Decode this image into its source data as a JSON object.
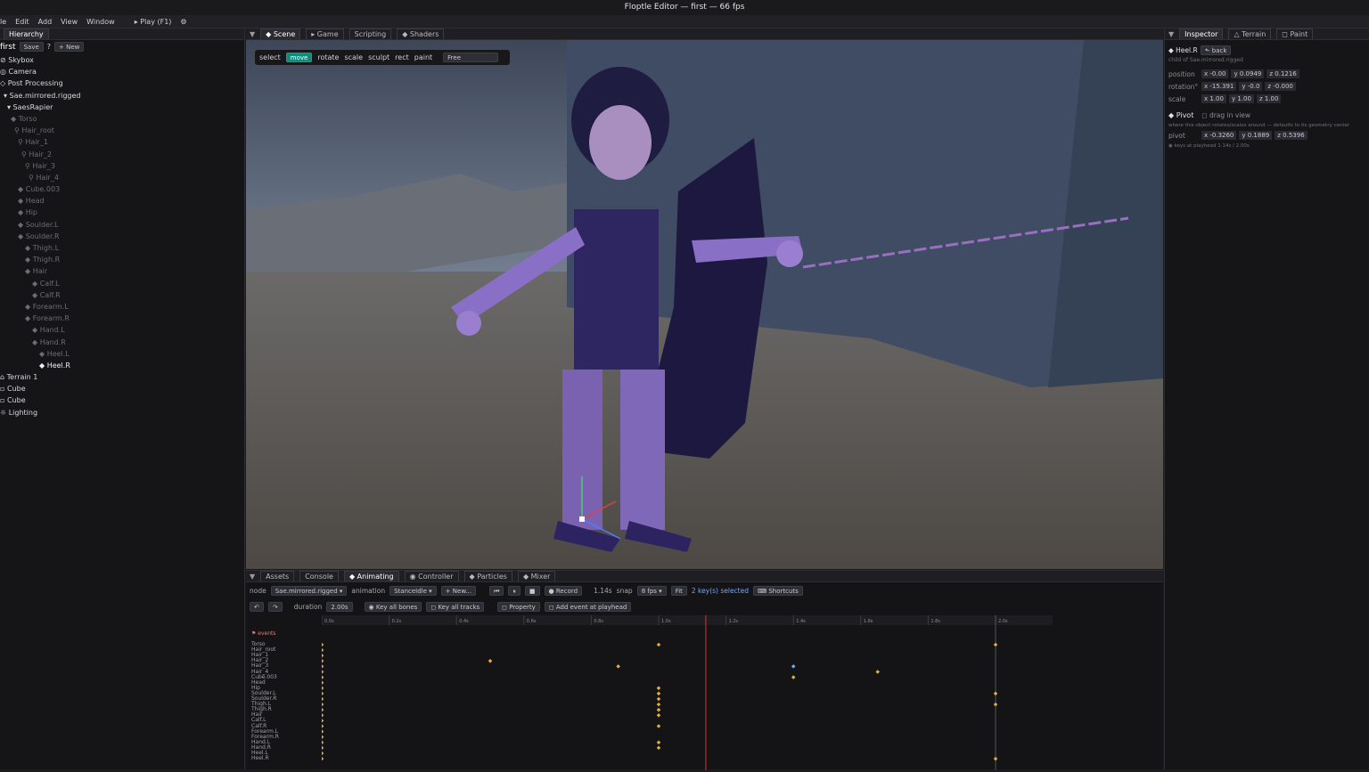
{
  "window": {
    "title": "Floptle Editor — first — 66 fps"
  },
  "menu": {
    "file": "le",
    "edit": "Edit",
    "add": "Add",
    "view": "View",
    "window": "Window",
    "play": "▸ Play (F1)",
    "gear": "⚙"
  },
  "hierarchy": {
    "tab": "Hierarchy",
    "project": "first",
    "save": "Save",
    "help": "?",
    "new": "+ New",
    "items": [
      {
        "label": "⊘ Skybox",
        "indent": 0,
        "dim": false
      },
      {
        "label": "◎ Camera",
        "indent": 0,
        "dim": false
      },
      {
        "label": "◇ Post Processing",
        "indent": 0,
        "dim": false
      },
      {
        "label": "▾ Sae.mirrored.rigged",
        "indent": 1,
        "dim": false
      },
      {
        "label": "▾ SaesRapier",
        "indent": 2,
        "dim": false
      },
      {
        "label": "◆ Torso",
        "indent": 3,
        "dim": true
      },
      {
        "label": "⚲ Hair_root",
        "indent": 4,
        "dim": true
      },
      {
        "label": "⚲ Hair_1",
        "indent": 5,
        "dim": true
      },
      {
        "label": "⚲ Hair_2",
        "indent": 6,
        "dim": true
      },
      {
        "label": "⚲ Hair_3",
        "indent": 7,
        "dim": true
      },
      {
        "label": "⚲ Hair_4",
        "indent": 8,
        "dim": true
      },
      {
        "label": "◆ Cube.003",
        "indent": 5,
        "dim": true
      },
      {
        "label": "◆ Head",
        "indent": 5,
        "dim": true
      },
      {
        "label": "◆ Hip",
        "indent": 5,
        "dim": true
      },
      {
        "label": "◆ Soulder.L",
        "indent": 5,
        "dim": true
      },
      {
        "label": "◆ Soulder.R",
        "indent": 5,
        "dim": true
      },
      {
        "label": "◆ Thigh.L",
        "indent": 7,
        "dim": true
      },
      {
        "label": "◆ Thigh.R",
        "indent": 7,
        "dim": true
      },
      {
        "label": "◆ Hair",
        "indent": 7,
        "dim": true
      },
      {
        "label": "◆ Calf.L",
        "indent": 9,
        "dim": true
      },
      {
        "label": "◆ Calf.R",
        "indent": 9,
        "dim": true
      },
      {
        "label": "◆ Forearm.L",
        "indent": 7,
        "dim": true
      },
      {
        "label": "◆ Forearm.R",
        "indent": 7,
        "dim": true
      },
      {
        "label": "◆ Hand.L",
        "indent": 9,
        "dim": true
      },
      {
        "label": "◆ Hand.R",
        "indent": 9,
        "dim": true
      },
      {
        "label": "◆ Heel.L",
        "indent": 11,
        "dim": true
      },
      {
        "label": "◆ Heel.R",
        "indent": 11,
        "dim": false
      },
      {
        "label": "⌂ Terrain 1",
        "indent": 0,
        "dim": false
      },
      {
        "label": "▫ Cube",
        "indent": 0,
        "dim": false
      },
      {
        "label": "▫ Cube",
        "indent": 0,
        "dim": false
      },
      {
        "label": "☼ Lighting",
        "indent": 0,
        "dim": false
      }
    ]
  },
  "scene": {
    "tabs": [
      "◆ Scene",
      "▸ Game",
      "Scripting",
      "◆ Shaders"
    ],
    "tools": {
      "label": "select",
      "move": "move",
      "rotate": "rotate",
      "scale": "scale",
      "sculpt": "sculpt",
      "rect": "rect",
      "paint": "paint",
      "mode": "Free"
    }
  },
  "inspector": {
    "tabs": [
      "Inspector",
      "△ Terrain",
      "◻ Paint"
    ],
    "node": "◆ Heel.R",
    "back": "⬑ back",
    "subtitle": "child of Sae.mirrored.rigged",
    "position": {
      "label": "position",
      "x": "x -0.00",
      "y": "y 0.0949",
      "z": "z 0.1216"
    },
    "rotation": {
      "label": "rotation°",
      "x": "x -15.391",
      "y": "y -0.0",
      "z": "z -0.000"
    },
    "scale": {
      "label": "scale",
      "x": "x 1.00",
      "y": "y 1.00",
      "z": "z 1.00"
    },
    "pivot_title": "◆ Pivot",
    "drag_in_view": "◻ drag in view",
    "pivot_note": "where this object rotates/scales around — defaults to its geometry center",
    "pivot": {
      "label": "pivot",
      "x": "x -0.3260",
      "y": "y 0.1889",
      "z": "z 0.5396"
    },
    "keys_note": "◉ keys at playhead 1.14s / 2.00s"
  },
  "bottom": {
    "tabs": [
      "Assets",
      "Console",
      "◆ Animating",
      "◉ Controller",
      "◆ Particles",
      "◆ Mixer"
    ],
    "node_label": "node",
    "node_value": "Sae.mirrored.rigged ▾",
    "animation_label": "animation",
    "animation_value": "StanceIdle ▾",
    "new": "+ New...",
    "record": "● Record",
    "time": "1.14s",
    "snap_label": "snap",
    "snap_value": "8 fps ▾",
    "fit": "Fit",
    "selected": "2 key(s) selected",
    "shortcuts": "⌨ Shortcuts",
    "duration_label": "duration",
    "duration_value": "2.00s",
    "key_all_bones": "◉ Key all bones",
    "key_all_tracks": "◻ Key all tracks",
    "property": "◻ Property",
    "add_event": "◻ Add event at playhead",
    "ticks": [
      "0.0s",
      "0.2s",
      "0.4s",
      "0.6s",
      "0.8s",
      "1.0s",
      "1.2s",
      "1.4s",
      "1.6s",
      "1.8s",
      "2.0s"
    ],
    "events": "⚑ events",
    "tracks": [
      "Torso",
      "Hair_root",
      "Hair_1",
      "Hair_2",
      "Hair_3",
      "Hair_4",
      "Cube.003",
      "Head",
      "Hip",
      "Soulder.L",
      "Soulder.R",
      "Thigh.L",
      "Thigh.R",
      "Hair",
      "Calf.L",
      "Calf.R",
      "Forearm.L",
      "Forearm.R",
      "Hand.L",
      "Hand.R",
      "Heel.L",
      "Heel.R"
    ],
    "playhead": 1.14
  }
}
